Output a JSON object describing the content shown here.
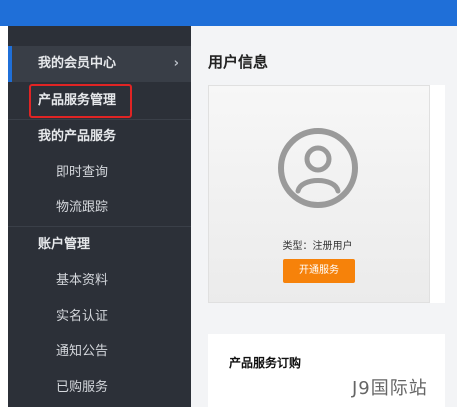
{
  "sidebar": {
    "items": [
      {
        "label": "我的会员中心",
        "chevron": "›"
      },
      {
        "label": "产品服务管理"
      },
      {
        "label": "我的产品服务"
      },
      {
        "label": "即时查询"
      },
      {
        "label": "物流跟踪"
      },
      {
        "label": "账户管理"
      },
      {
        "label": "基本资料"
      },
      {
        "label": "实名认证"
      },
      {
        "label": "通知公告"
      },
      {
        "label": "已购服务"
      }
    ]
  },
  "main": {
    "title": "用户信息",
    "user_card": {
      "type_label": "类型：注册用户",
      "open_button": "开通服务"
    },
    "section2_title": "产品服务订购"
  },
  "watermark": "J9国际站",
  "colors": {
    "topbar": "#1f6fd8",
    "sidebar": "#2c3038",
    "accent_button": "#f6820a",
    "highlight": "#e02424"
  }
}
